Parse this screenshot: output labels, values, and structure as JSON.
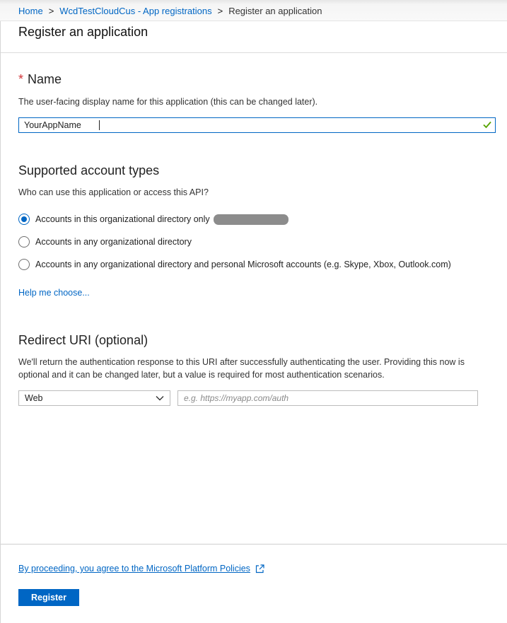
{
  "breadcrumb": {
    "home": "Home",
    "tenant": "WcdTestCloudCus - App registrations",
    "current": "Register an application",
    "separator": ">"
  },
  "page": {
    "title": "Register an application"
  },
  "name_section": {
    "required_marker": "*",
    "title": "Name",
    "description": "The user-facing display name for this application (this can be changed later).",
    "input_value": "YourAppName",
    "valid_icon": "checkmark-icon"
  },
  "account_types": {
    "title": "Supported account types",
    "question": "Who can use this application or access this API?",
    "options": [
      {
        "label": "Accounts in this organizational directory only",
        "selected": true
      },
      {
        "label": "Accounts in any organizational directory",
        "selected": false
      },
      {
        "label": "Accounts in any organizational directory and personal Microsoft accounts (e.g. Skype, Xbox, Outlook.com)",
        "selected": false
      }
    ],
    "help_link": "Help me choose..."
  },
  "redirect": {
    "title": "Redirect URI (optional)",
    "description": "We'll return the authentication response to this URI after successfully authenticating the user. Providing this now is optional and it can be changed later, but a value is required for most authentication scenarios.",
    "platform_value": "Web",
    "uri_placeholder": "e.g. https://myapp.com/auth"
  },
  "footer": {
    "policy_text": "By proceeding, you agree to the Microsoft Platform Policies",
    "policy_icon": "external-link-icon",
    "register_label": "Register"
  },
  "colors": {
    "accent": "#0066c4",
    "required": "#d13438",
    "valid": "#57a300"
  }
}
